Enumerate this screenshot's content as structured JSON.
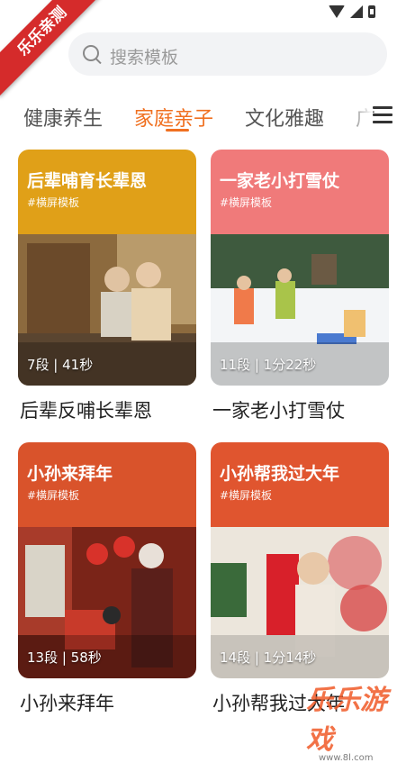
{
  "ribbon": "乐乐亲测",
  "search": {
    "placeholder": "搜索模板"
  },
  "tabs": [
    "健康养生",
    "家庭亲子",
    "文化雅趣",
    "广"
  ],
  "active_tab": 1,
  "cards": [
    {
      "banner_title": "后辈哺育长辈恩",
      "banner_tag": "#横屏模板",
      "info": "7段 | 41秒",
      "caption": "后辈反哺长辈恩",
      "banner_color": "#e0a018"
    },
    {
      "banner_title": "一家老小打雪仗",
      "banner_tag": "#横屏模板",
      "info": "11段 | 1分22秒",
      "caption": "一家老小打雪仗",
      "banner_color": "#f07a7a"
    },
    {
      "banner_title": "小孙来拜年",
      "banner_tag": "#横屏模板",
      "info": "13段 | 58秒",
      "caption": "小孙来拜年",
      "banner_color": "#d9532b"
    },
    {
      "banner_title": "小孙帮我过大年",
      "banner_tag": "#横屏模板",
      "info": "14段 | 1分14秒",
      "caption": "小孙帮我过大年",
      "banner_color": "#e0552f"
    }
  ],
  "watermark": {
    "text": "乐乐游戏",
    "url": "www.8l.com"
  }
}
